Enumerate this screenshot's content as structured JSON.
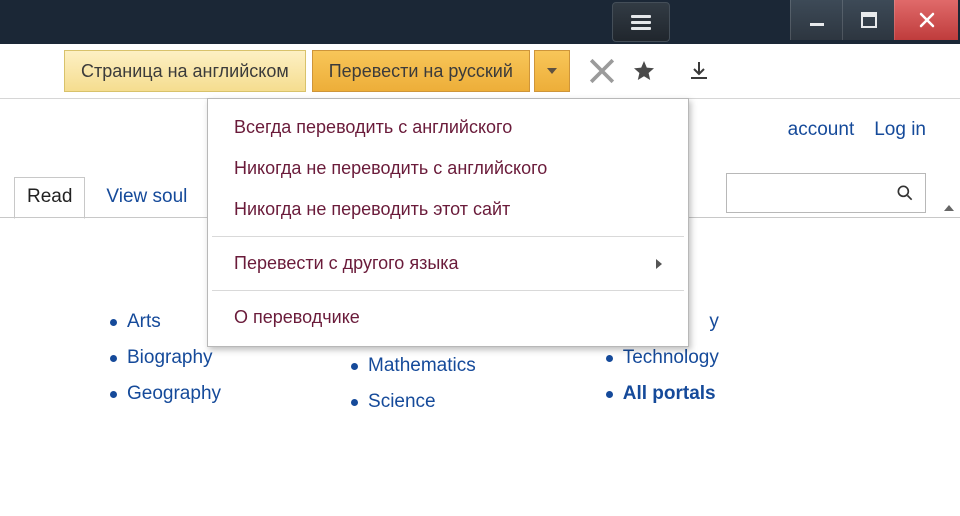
{
  "toolbar": {
    "lang_chip": "Страница на английском",
    "translate_chip": "Перевести на русский"
  },
  "dropdown": {
    "always": "Всегда переводить с английского",
    "never_lang": "Никогда не переводить с английского",
    "never_site": "Никогда не переводить этот сайт",
    "other_lang": "Перевести с другого языка",
    "about": "О переводчике"
  },
  "account": {
    "create": "account",
    "login": "Log in"
  },
  "tabs": {
    "read": "Read",
    "view_source": "View soul"
  },
  "portals": {
    "col1": [
      "Arts",
      "Biography",
      "Geography"
    ],
    "col2": [
      "Mathematics",
      "Science"
    ],
    "col3_partial": "y",
    "col3": [
      "Technology",
      "All portals"
    ]
  }
}
